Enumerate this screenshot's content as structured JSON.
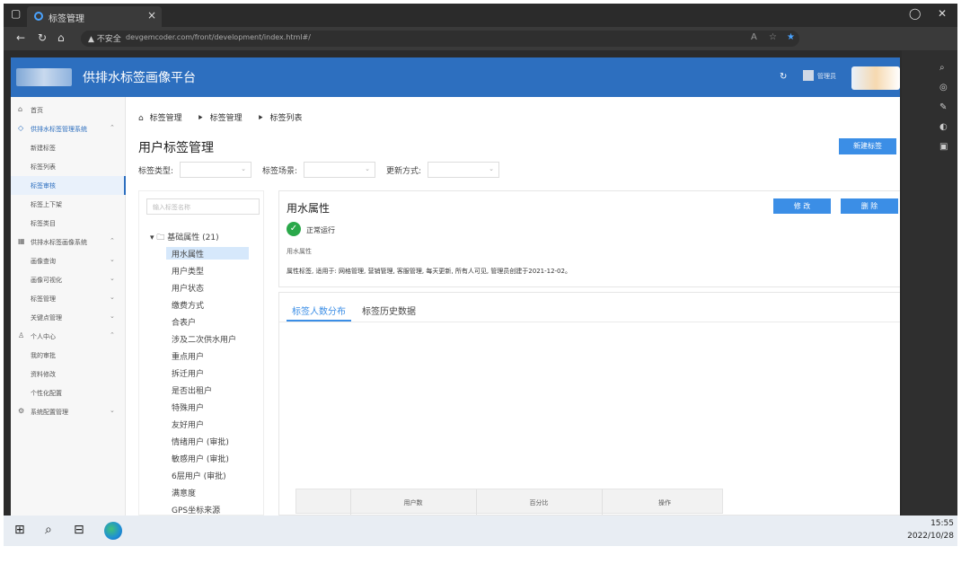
{
  "browser": {
    "tab_title": "标签管理",
    "tab_close": "×",
    "address_warning": "▲ 不安全",
    "url": "devgemcoder.com/front/development/index.html#/",
    "win_restore": "◯",
    "win_close": "✕"
  },
  "app": {
    "title": "供排水标签画像平台",
    "username": "管理员"
  },
  "sidebar": {
    "items": [
      {
        "label": "首页",
        "icon": "home-icon"
      },
      {
        "label": "供排水标签管理系统",
        "icon": "tag-icon"
      },
      {
        "label": "新建标签"
      },
      {
        "label": "标签列表"
      },
      {
        "label": "标签审核"
      },
      {
        "label": "标签上下架"
      },
      {
        "label": "标签类目"
      },
      {
        "label": "供排水标签画像系统",
        "icon": "grid-icon"
      },
      {
        "label": "画像查询"
      },
      {
        "label": "画像可视化"
      },
      {
        "label": "标签管理"
      },
      {
        "label": "关键点管理"
      },
      {
        "label": "个人中心",
        "icon": "user-icon"
      },
      {
        "label": "我的审批"
      },
      {
        "label": "资料修改"
      },
      {
        "label": "个性化配置"
      },
      {
        "label": "系统配置管理",
        "icon": "gear-icon"
      }
    ]
  },
  "breadcrumb": {
    "home": "标签管理",
    "level2": "标签管理",
    "level3": "标签列表"
  },
  "page": {
    "title": "用户标签管理",
    "new_button": "新建标签"
  },
  "filters": {
    "type_label": "标签类型:",
    "scene_label": "标签场景:",
    "update_label": "更新方式:"
  },
  "tree": {
    "search_placeholder": "输入标签名称",
    "root": "基础属性 (21)",
    "nodes": [
      "用水属性",
      "用户类型",
      "用户状态",
      "缴费方式",
      "合表户",
      "涉及二次供水用户",
      "重点用户",
      "拆迁用户",
      "是否出租户",
      "特殊用户",
      "友好用户",
      "情绪用户 (审批)",
      "敏感用户 (审批)",
      "6层用户 (审批)",
      "满意度",
      "GPS坐标来源"
    ]
  },
  "detail": {
    "title": "用水属性",
    "edit_button": "修 改",
    "delete_button": "删 除",
    "status": "正常运行",
    "subtitle": "用水属性",
    "description": "属性标签, 适用于: 网格管理, 营销管理, 客服管理, 每天更新, 所有人可见, 管理员创建于2021-12-02。"
  },
  "panel": {
    "tab_distribution": "标签人数分布",
    "tab_history": "标签历史数据",
    "col_users": "用户数",
    "col_percent": "百分比",
    "col_action": "操作"
  },
  "taskbar": {
    "time": "15:55",
    "date": "2022/10/28"
  }
}
